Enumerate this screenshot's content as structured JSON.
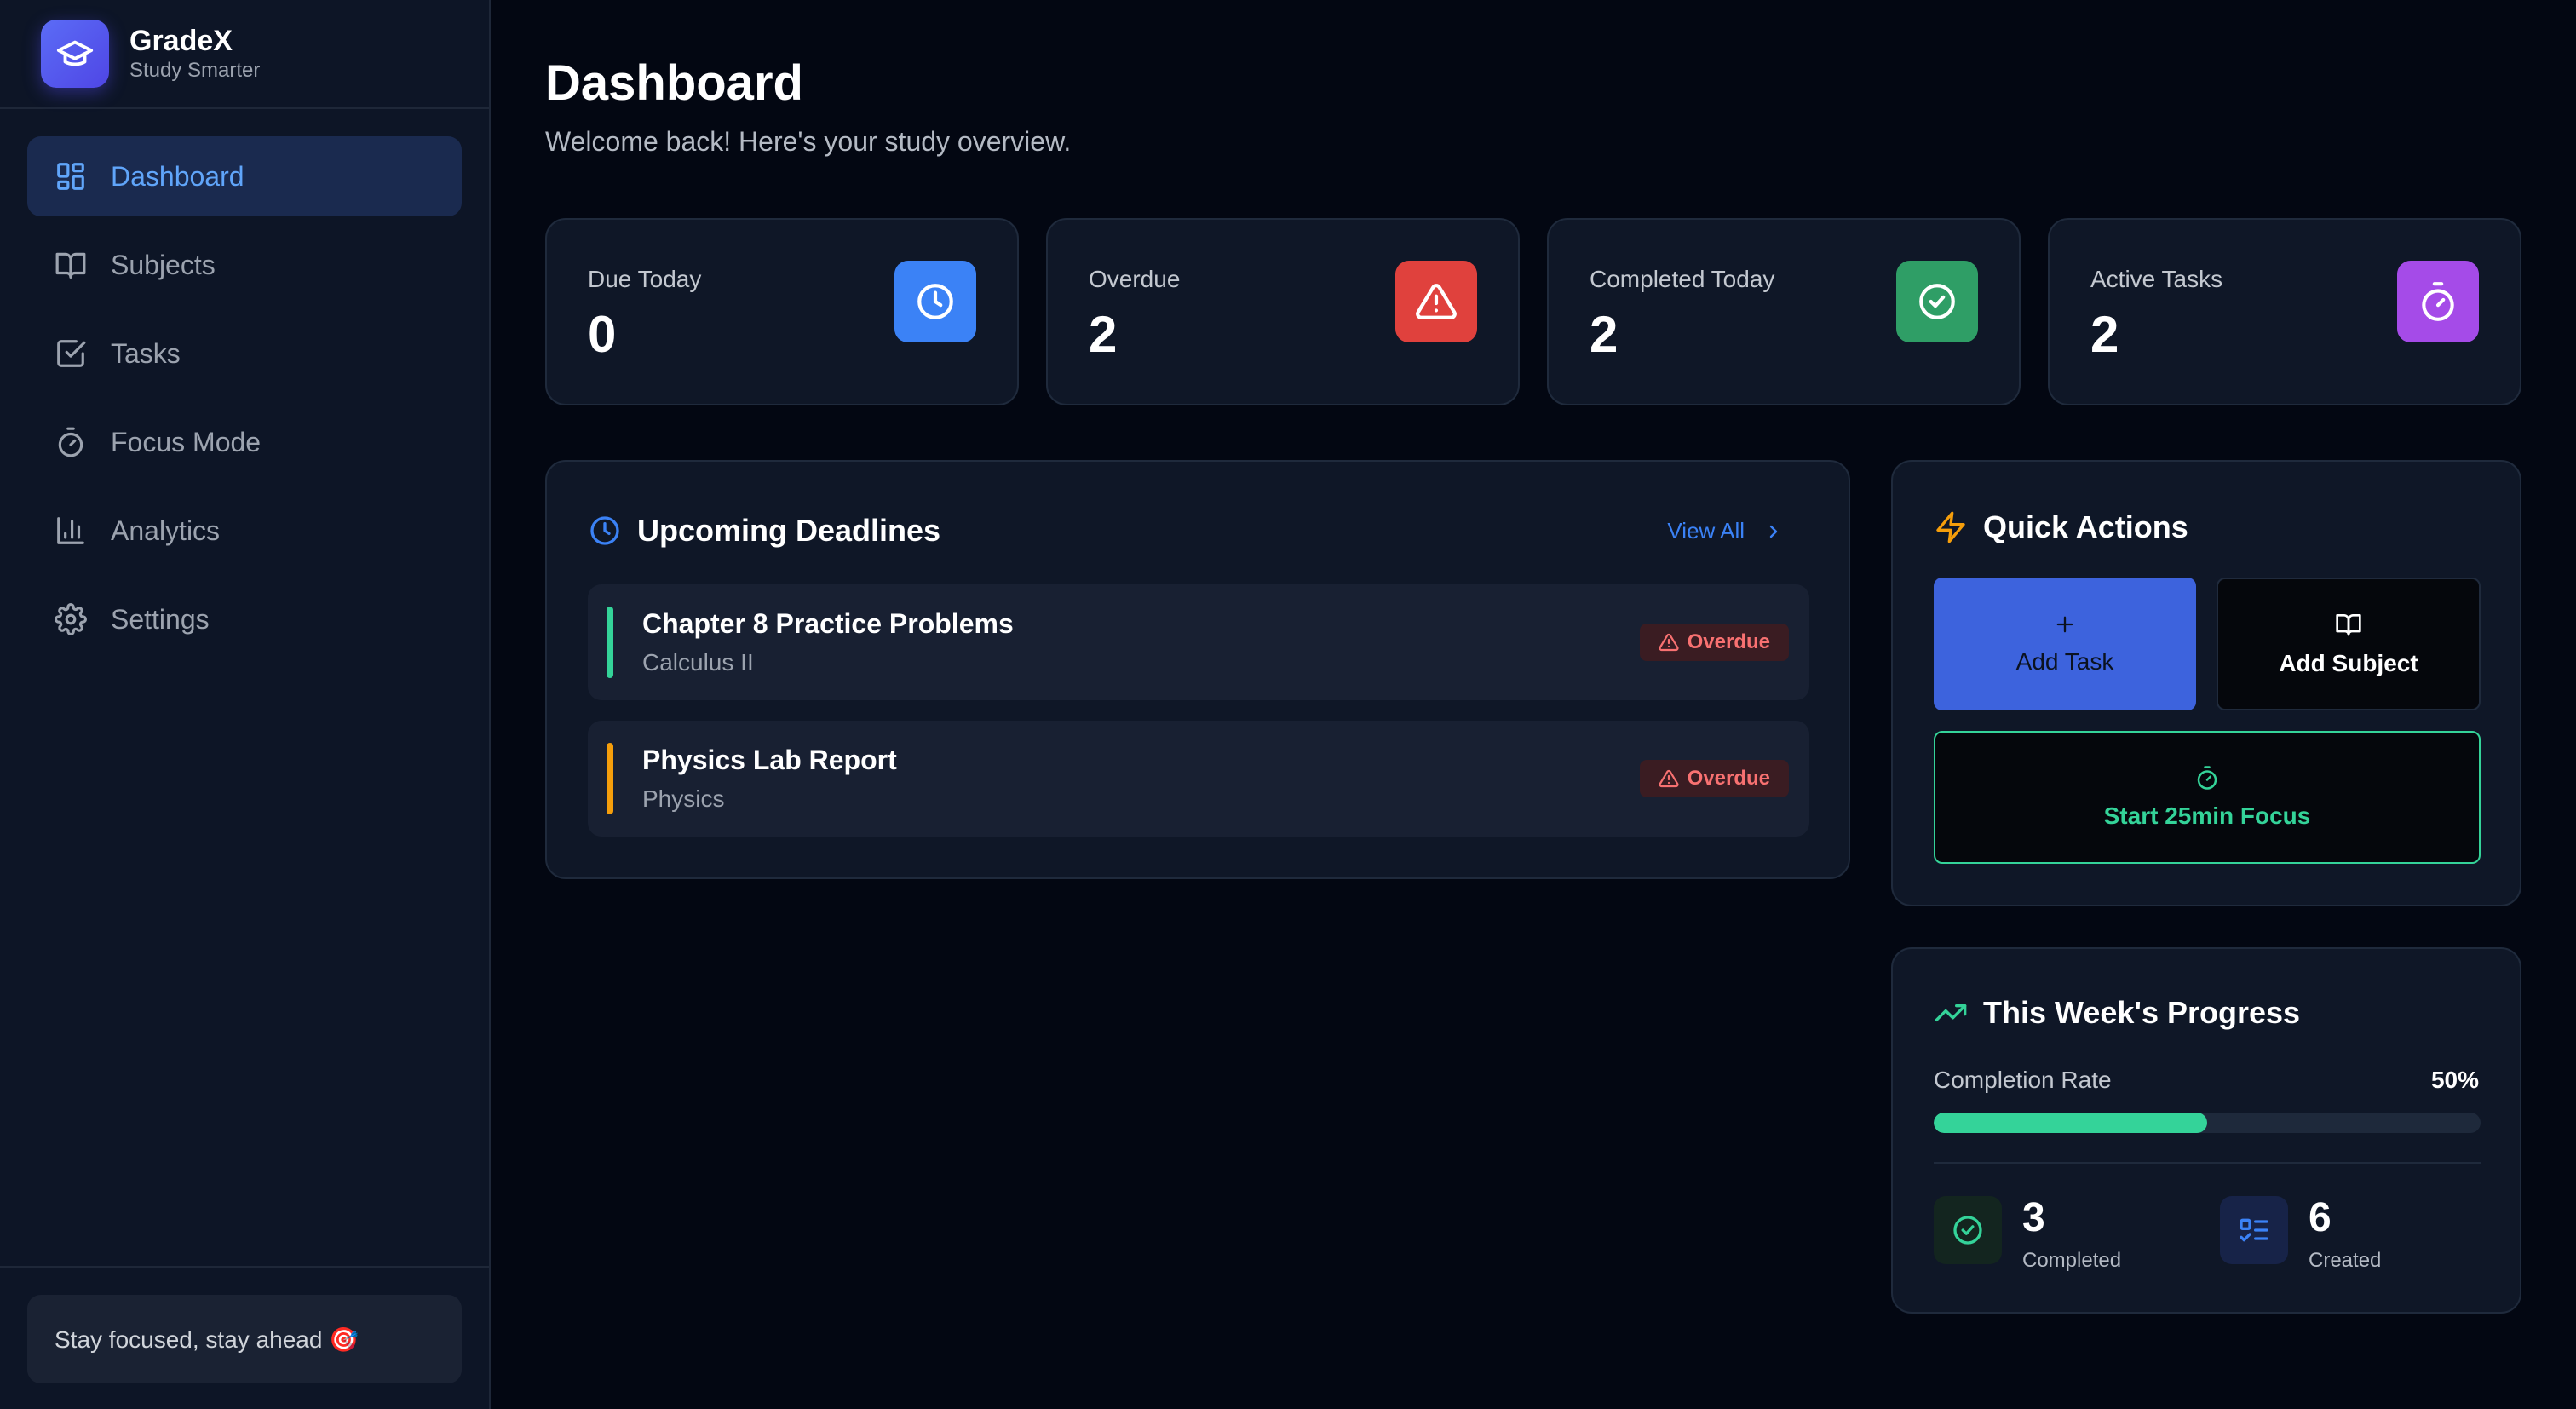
{
  "brand": {
    "name": "GradeX",
    "tagline": "Study Smarter"
  },
  "sidebar": {
    "items": [
      {
        "label": "Dashboard",
        "icon": "dashboard-icon",
        "active": true
      },
      {
        "label": "Subjects",
        "icon": "book-icon"
      },
      {
        "label": "Tasks",
        "icon": "checkbox-icon"
      },
      {
        "label": "Focus Mode",
        "icon": "timer-icon"
      },
      {
        "label": "Analytics",
        "icon": "bar-chart-icon"
      },
      {
        "label": "Settings",
        "icon": "gear-icon"
      }
    ],
    "footer_text": "Stay focused, stay ahead 🎯"
  },
  "header": {
    "title": "Dashboard",
    "subtitle": "Welcome back! Here's your study overview."
  },
  "stats": [
    {
      "label": "Due Today",
      "value": "0",
      "icon": "clock-icon",
      "color": "#3b82f6"
    },
    {
      "label": "Overdue",
      "value": "2",
      "icon": "warning-icon",
      "color": "#ef4444"
    },
    {
      "label": "Completed Today",
      "value": "2",
      "icon": "check-circle-icon",
      "color": "#22a45d"
    },
    {
      "label": "Active Tasks",
      "value": "2",
      "icon": "timer-icon",
      "color": "#a855f7"
    }
  ],
  "deadlines": {
    "title": "Upcoming Deadlines",
    "view_all": "View All",
    "items": [
      {
        "title": "Chapter 8 Practice Problems",
        "subject": "Calculus II",
        "status": "Overdue",
        "color": "#34d399"
      },
      {
        "title": "Physics Lab Report",
        "subject": "Physics",
        "status": "Overdue",
        "color": "#f59e0b"
      }
    ]
  },
  "quick_actions": {
    "title": "Quick Actions",
    "add_task": "Add Task",
    "add_subject": "Add Subject",
    "start_focus": "Start 25min Focus"
  },
  "progress": {
    "title": "This Week's Progress",
    "rate_label": "Completion Rate",
    "rate_value": "50%",
    "rate_fraction": 0.5,
    "completed_count": "3",
    "completed_label": "Completed",
    "created_count": "6",
    "created_label": "Created"
  },
  "colors": {
    "accent": "#3b82f6",
    "success": "#34d399",
    "danger": "#ef4444",
    "warning": "#f59e0b",
    "purple": "#a855f7"
  }
}
